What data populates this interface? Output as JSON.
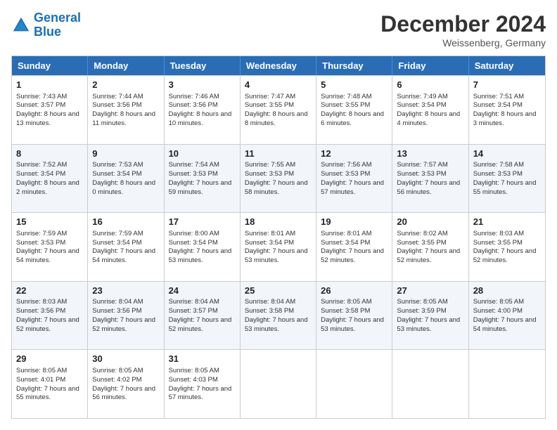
{
  "header": {
    "logo_line1": "General",
    "logo_line2": "Blue",
    "month_title": "December 2024",
    "location": "Weissenberg, Germany"
  },
  "weekdays": [
    "Sunday",
    "Monday",
    "Tuesday",
    "Wednesday",
    "Thursday",
    "Friday",
    "Saturday"
  ],
  "rows": [
    [
      {
        "day": "1",
        "sunrise": "Sunrise: 7:43 AM",
        "sunset": "Sunset: 3:57 PM",
        "daylight": "Daylight: 8 hours and 13 minutes."
      },
      {
        "day": "2",
        "sunrise": "Sunrise: 7:44 AM",
        "sunset": "Sunset: 3:56 PM",
        "daylight": "Daylight: 8 hours and 11 minutes."
      },
      {
        "day": "3",
        "sunrise": "Sunrise: 7:46 AM",
        "sunset": "Sunset: 3:56 PM",
        "daylight": "Daylight: 8 hours and 10 minutes."
      },
      {
        "day": "4",
        "sunrise": "Sunrise: 7:47 AM",
        "sunset": "Sunset: 3:55 PM",
        "daylight": "Daylight: 8 hours and 8 minutes."
      },
      {
        "day": "5",
        "sunrise": "Sunrise: 7:48 AM",
        "sunset": "Sunset: 3:55 PM",
        "daylight": "Daylight: 8 hours and 6 minutes."
      },
      {
        "day": "6",
        "sunrise": "Sunrise: 7:49 AM",
        "sunset": "Sunset: 3:54 PM",
        "daylight": "Daylight: 8 hours and 4 minutes."
      },
      {
        "day": "7",
        "sunrise": "Sunrise: 7:51 AM",
        "sunset": "Sunset: 3:54 PM",
        "daylight": "Daylight: 8 hours and 3 minutes."
      }
    ],
    [
      {
        "day": "8",
        "sunrise": "Sunrise: 7:52 AM",
        "sunset": "Sunset: 3:54 PM",
        "daylight": "Daylight: 8 hours and 2 minutes."
      },
      {
        "day": "9",
        "sunrise": "Sunrise: 7:53 AM",
        "sunset": "Sunset: 3:54 PM",
        "daylight": "Daylight: 8 hours and 0 minutes."
      },
      {
        "day": "10",
        "sunrise": "Sunrise: 7:54 AM",
        "sunset": "Sunset: 3:53 PM",
        "daylight": "Daylight: 7 hours and 59 minutes."
      },
      {
        "day": "11",
        "sunrise": "Sunrise: 7:55 AM",
        "sunset": "Sunset: 3:53 PM",
        "daylight": "Daylight: 7 hours and 58 minutes."
      },
      {
        "day": "12",
        "sunrise": "Sunrise: 7:56 AM",
        "sunset": "Sunset: 3:53 PM",
        "daylight": "Daylight: 7 hours and 57 minutes."
      },
      {
        "day": "13",
        "sunrise": "Sunrise: 7:57 AM",
        "sunset": "Sunset: 3:53 PM",
        "daylight": "Daylight: 7 hours and 56 minutes."
      },
      {
        "day": "14",
        "sunrise": "Sunrise: 7:58 AM",
        "sunset": "Sunset: 3:53 PM",
        "daylight": "Daylight: 7 hours and 55 minutes."
      }
    ],
    [
      {
        "day": "15",
        "sunrise": "Sunrise: 7:59 AM",
        "sunset": "Sunset: 3:53 PM",
        "daylight": "Daylight: 7 hours and 54 minutes."
      },
      {
        "day": "16",
        "sunrise": "Sunrise: 7:59 AM",
        "sunset": "Sunset: 3:54 PM",
        "daylight": "Daylight: 7 hours and 54 minutes."
      },
      {
        "day": "17",
        "sunrise": "Sunrise: 8:00 AM",
        "sunset": "Sunset: 3:54 PM",
        "daylight": "Daylight: 7 hours and 53 minutes."
      },
      {
        "day": "18",
        "sunrise": "Sunrise: 8:01 AM",
        "sunset": "Sunset: 3:54 PM",
        "daylight": "Daylight: 7 hours and 53 minutes."
      },
      {
        "day": "19",
        "sunrise": "Sunrise: 8:01 AM",
        "sunset": "Sunset: 3:54 PM",
        "daylight": "Daylight: 7 hours and 52 minutes."
      },
      {
        "day": "20",
        "sunrise": "Sunrise: 8:02 AM",
        "sunset": "Sunset: 3:55 PM",
        "daylight": "Daylight: 7 hours and 52 minutes."
      },
      {
        "day": "21",
        "sunrise": "Sunrise: 8:03 AM",
        "sunset": "Sunset: 3:55 PM",
        "daylight": "Daylight: 7 hours and 52 minutes."
      }
    ],
    [
      {
        "day": "22",
        "sunrise": "Sunrise: 8:03 AM",
        "sunset": "Sunset: 3:56 PM",
        "daylight": "Daylight: 7 hours and 52 minutes."
      },
      {
        "day": "23",
        "sunrise": "Sunrise: 8:04 AM",
        "sunset": "Sunset: 3:56 PM",
        "daylight": "Daylight: 7 hours and 52 minutes."
      },
      {
        "day": "24",
        "sunrise": "Sunrise: 8:04 AM",
        "sunset": "Sunset: 3:57 PM",
        "daylight": "Daylight: 7 hours and 52 minutes."
      },
      {
        "day": "25",
        "sunrise": "Sunrise: 8:04 AM",
        "sunset": "Sunset: 3:58 PM",
        "daylight": "Daylight: 7 hours and 53 minutes."
      },
      {
        "day": "26",
        "sunrise": "Sunrise: 8:05 AM",
        "sunset": "Sunset: 3:58 PM",
        "daylight": "Daylight: 7 hours and 53 minutes."
      },
      {
        "day": "27",
        "sunrise": "Sunrise: 8:05 AM",
        "sunset": "Sunset: 3:59 PM",
        "daylight": "Daylight: 7 hours and 53 minutes."
      },
      {
        "day": "28",
        "sunrise": "Sunrise: 8:05 AM",
        "sunset": "Sunset: 4:00 PM",
        "daylight": "Daylight: 7 hours and 54 minutes."
      }
    ],
    [
      {
        "day": "29",
        "sunrise": "Sunrise: 8:05 AM",
        "sunset": "Sunset: 4:01 PM",
        "daylight": "Daylight: 7 hours and 55 minutes."
      },
      {
        "day": "30",
        "sunrise": "Sunrise: 8:05 AM",
        "sunset": "Sunset: 4:02 PM",
        "daylight": "Daylight: 7 hours and 56 minutes."
      },
      {
        "day": "31",
        "sunrise": "Sunrise: 8:05 AM",
        "sunset": "Sunset: 4:03 PM",
        "daylight": "Daylight: 7 hours and 57 minutes."
      },
      null,
      null,
      null,
      null
    ]
  ]
}
